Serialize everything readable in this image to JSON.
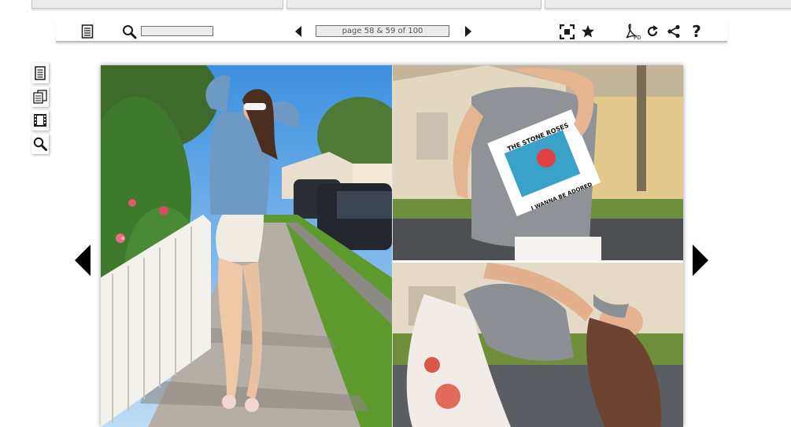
{
  "toolbar": {
    "search_placeholder": "",
    "page_indicator": "page 58 & 59 of 100",
    "icons": [
      "contents-icon",
      "search-icon",
      "prev-page-icon",
      "next-page-icon",
      "fullscreen-icon",
      "bookmark-star-icon",
      "pdf-download-icon",
      "rotate-icon",
      "share-icon",
      "help-icon"
    ],
    "help_label": "?"
  },
  "side_tools": [
    "table-of-contents-icon",
    "pages-icon",
    "video-icon",
    "search-icon"
  ],
  "photo": {
    "shirt_text_top": "THE STONE ROSES",
    "shirt_text_bottom": "I WANNA BE ADORED"
  },
  "colors": {
    "icon": "#1a1a1a",
    "toolbar_field_bg": "#ececec",
    "nav_arrow": "#000000"
  }
}
